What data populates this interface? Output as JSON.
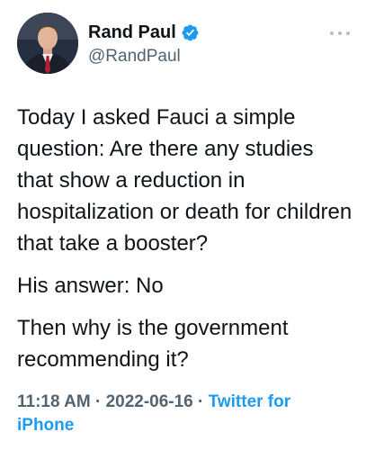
{
  "author": {
    "display_name": "Rand Paul",
    "handle": "@RandPaul",
    "verified": true,
    "avatar_icon": "profile-photo"
  },
  "menu": {
    "icon": "more-horizontal-icon"
  },
  "tweet": {
    "paragraphs": [
      "Today I asked Fauci a simple question: Are there any studies that show a reduction in hospitalization or death for children that take a booster?",
      "His answer: No",
      "Then why is the government recommending it?"
    ]
  },
  "footer": {
    "time": "11:18 AM",
    "separator1": " · ",
    "date": "2022-06-16",
    "separator2": " · ",
    "source": "Twitter for iPhone"
  },
  "colors": {
    "text": "#0f1419",
    "secondary": "#536471",
    "accent": "#1d9bf0"
  }
}
